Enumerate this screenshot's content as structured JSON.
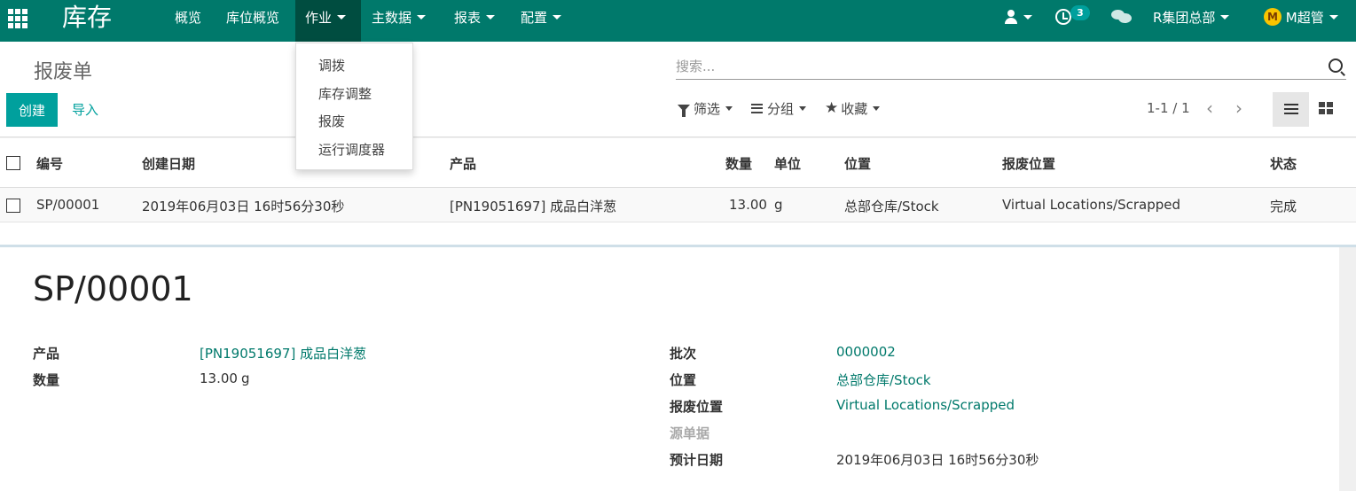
{
  "navbar": {
    "brand": "库存",
    "menus": [
      "概览",
      "库位概览",
      "作业",
      "主数据",
      "报表",
      "配置"
    ],
    "activities_count": "3",
    "company": "R集团总部",
    "user_avatar_text": "M",
    "user": "M超管"
  },
  "dropdown": {
    "items": [
      "调拨",
      "库存调整",
      "报废",
      "运行调度器"
    ]
  },
  "control_panel": {
    "breadcrumb": "报废单",
    "create_label": "创建",
    "import_label": "导入",
    "search_placeholder": "搜索...",
    "filter_label": "筛选",
    "group_label": "分组",
    "favorites_label": "收藏",
    "pager": "1-1 / 1"
  },
  "list": {
    "columns": [
      "编号",
      "创建日期",
      "产品",
      "数量",
      "单位",
      "位置",
      "报废位置",
      "状态"
    ],
    "rows": [
      {
        "ref": "SP/00001",
        "date": "2019年06月03日 16时56分30秒",
        "product": "[PN19051697] 成品白洋葱",
        "qty": "13.00",
        "uom": "g",
        "location": "总部仓库/Stock",
        "scrap_location": "Virtual Locations/Scrapped",
        "state": "完成"
      }
    ]
  },
  "form": {
    "title": "SP/00001",
    "product_label": "产品",
    "product_value": "[PN19051697] 成品白洋葱",
    "qty_label": "数量",
    "qty_value": "13.00",
    "qty_uom": "g",
    "lot_label": "批次",
    "lot_value": "0000002",
    "location_label": "位置",
    "location_value": "总部仓库/Stock",
    "scrap_location_label": "报废位置",
    "scrap_location_value": "Virtual Locations/Scrapped",
    "origin_label": "源单据",
    "date_expected_label": "预计日期",
    "date_expected_value": "2019年06月03日 16时56分30秒"
  },
  "colors": {
    "navbar": "#00796b",
    "navbar_active": "#004d40",
    "primary": "#00a09d",
    "link": "#00796b"
  }
}
